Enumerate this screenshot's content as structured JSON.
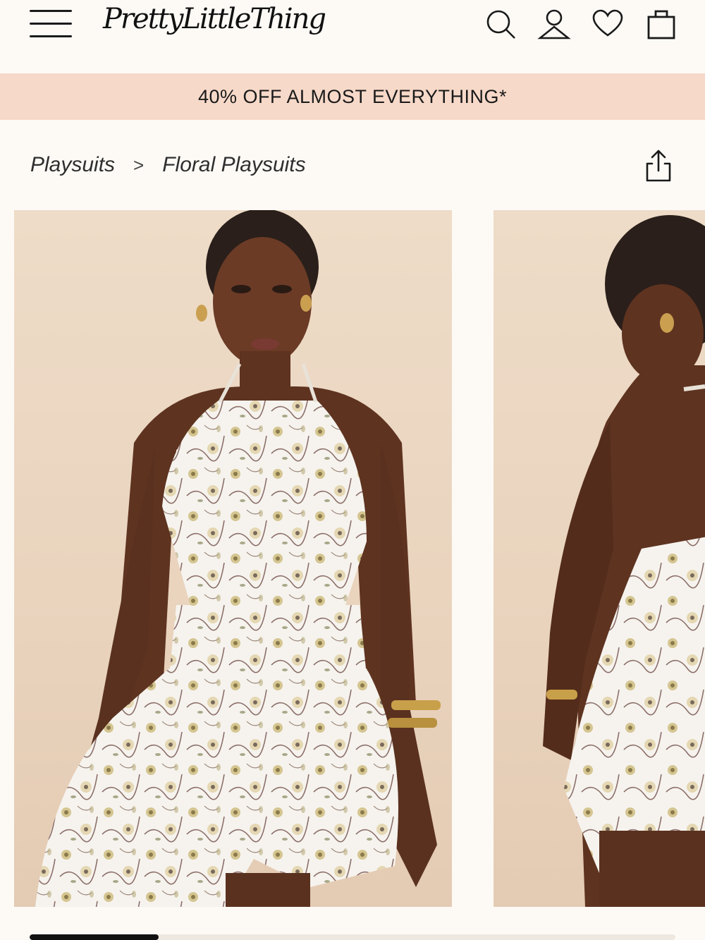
{
  "header": {
    "logo_text": "PrettyLittleThing",
    "icons": [
      "menu-icon",
      "search-icon",
      "account-icon",
      "heart-icon",
      "bag-icon"
    ]
  },
  "promo": {
    "text": "40% OFF ALMOST EVERYTHING*",
    "background": "#f7d9c9"
  },
  "breadcrumb": {
    "items": [
      "Playsuits",
      "Floral Playsuits"
    ],
    "separator": ">"
  },
  "gallery": {
    "image_count_visible": 2,
    "progress_fraction": 0.2
  },
  "colors": {
    "background": "#fdfaf6",
    "text": "#1a1a1a",
    "promo": "#f7d9c9",
    "photo_backdrop": "#eedcc8"
  }
}
